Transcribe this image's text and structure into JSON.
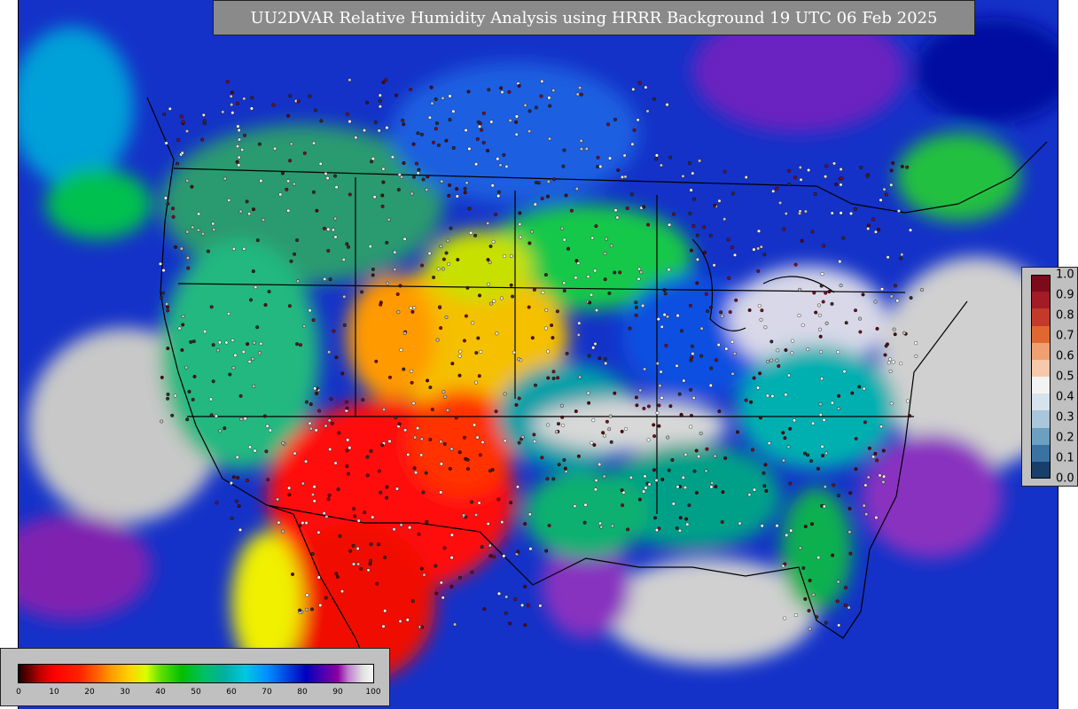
{
  "title": "UU2DVAR Relative Humidity Analysis using HRRR Background 19 UTC 06 Feb 2025",
  "colors": {
    "ocean_moist": "#1030d0",
    "very_moist": "#c8c8c8",
    "dry_core": "#ff1010",
    "mid": "#00c000",
    "land_moist": "#00b0b0"
  },
  "rh_colorbar": {
    "ticks": [
      "0",
      "10",
      "20",
      "30",
      "40",
      "50",
      "60",
      "70",
      "80",
      "90",
      "100"
    ]
  },
  "innovation_colorbar": {
    "ticks": [
      "1.0",
      "0.9",
      "0.8",
      "0.7",
      "0.6",
      "0.5",
      "0.4",
      "0.3",
      "0.2",
      "0.1",
      "0.0"
    ],
    "colors": [
      "#7d0a1a",
      "#a31b25",
      "#c33a2a",
      "#e0672f",
      "#f0a070",
      "#f6c9aa",
      "#f3f3f3",
      "#d7e3ec",
      "#a9c6da",
      "#6d9fc0",
      "#3a72a2",
      "#183e6a"
    ]
  }
}
